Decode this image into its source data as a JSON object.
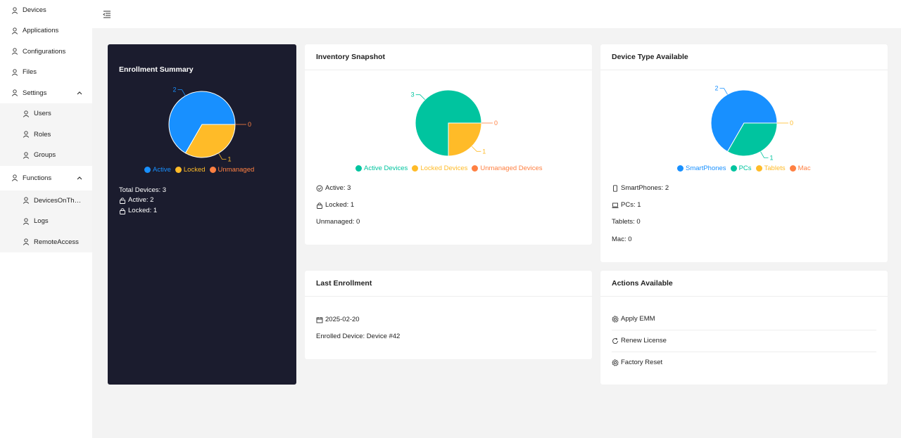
{
  "sidebar": {
    "items": [
      {
        "label": "Devices",
        "type": "item"
      },
      {
        "label": "Applications",
        "type": "item"
      },
      {
        "label": "Configurations",
        "type": "item"
      },
      {
        "label": "Files",
        "type": "item"
      },
      {
        "label": "Settings",
        "type": "group"
      },
      {
        "label": "Users",
        "type": "sub"
      },
      {
        "label": "Roles",
        "type": "sub"
      },
      {
        "label": "Groups",
        "type": "sub"
      },
      {
        "label": "Functions",
        "type": "group"
      },
      {
        "label": "DevicesOnThe...",
        "type": "sub"
      },
      {
        "label": "Logs",
        "type": "sub"
      },
      {
        "label": "RemoteAccess",
        "type": "sub"
      }
    ]
  },
  "colors": {
    "blue": "#1890ff",
    "teal": "#00c49f",
    "yellow": "#ffbb28",
    "orange": "#ff8042",
    "dark": "#1b1c2e"
  },
  "enrollment": {
    "title": "Enrollment Summary",
    "total": "Total Devices: 3",
    "active": "Active: 2",
    "locked": "Locked: 1"
  },
  "inventory": {
    "title": "Inventory Snapshot",
    "active": "Active: 3",
    "locked": "Locked: 1",
    "unmanaged": "Unmanaged: 0"
  },
  "device_type": {
    "title": "Device Type Available",
    "smartphones": "SmartPhones: 2",
    "pcs": "PCs: 1",
    "tablets": "Tablets: 0",
    "mac": "Mac: 0"
  },
  "last_enrollment": {
    "title": "Last Enrollment",
    "date": "2025-02-20",
    "device": "Enrolled Device: Device #42"
  },
  "actions": {
    "title": "Actions Available",
    "items": [
      "Apply EMM",
      "Renew License",
      "Factory Reset"
    ]
  },
  "chart_data": [
    {
      "type": "pie",
      "title": "Enrollment Summary",
      "categories": [
        "Active",
        "Locked",
        "Unmanaged"
      ],
      "values": [
        2,
        1,
        0
      ],
      "colors": [
        "#1890ff",
        "#ffbb28",
        "#ff8042"
      ],
      "labels": [
        "2",
        "1",
        "0"
      ]
    },
    {
      "type": "pie",
      "title": "Inventory Snapshot",
      "categories": [
        "Active Devices",
        "Locked Devices",
        "Unmanaged Devices"
      ],
      "values": [
        3,
        1,
        0
      ],
      "colors": [
        "#00c49f",
        "#ffbb28",
        "#ff8042"
      ],
      "labels": [
        "3",
        "1",
        "0"
      ]
    },
    {
      "type": "pie",
      "title": "Device Type Available",
      "categories": [
        "SmartPhones",
        "PCs",
        "Tablets",
        "Mac"
      ],
      "values": [
        2,
        1,
        0,
        0
      ],
      "colors": [
        "#1890ff",
        "#00c49f",
        "#ffbb28",
        "#ff8042"
      ],
      "labels": [
        "2",
        "1",
        "0"
      ]
    }
  ]
}
